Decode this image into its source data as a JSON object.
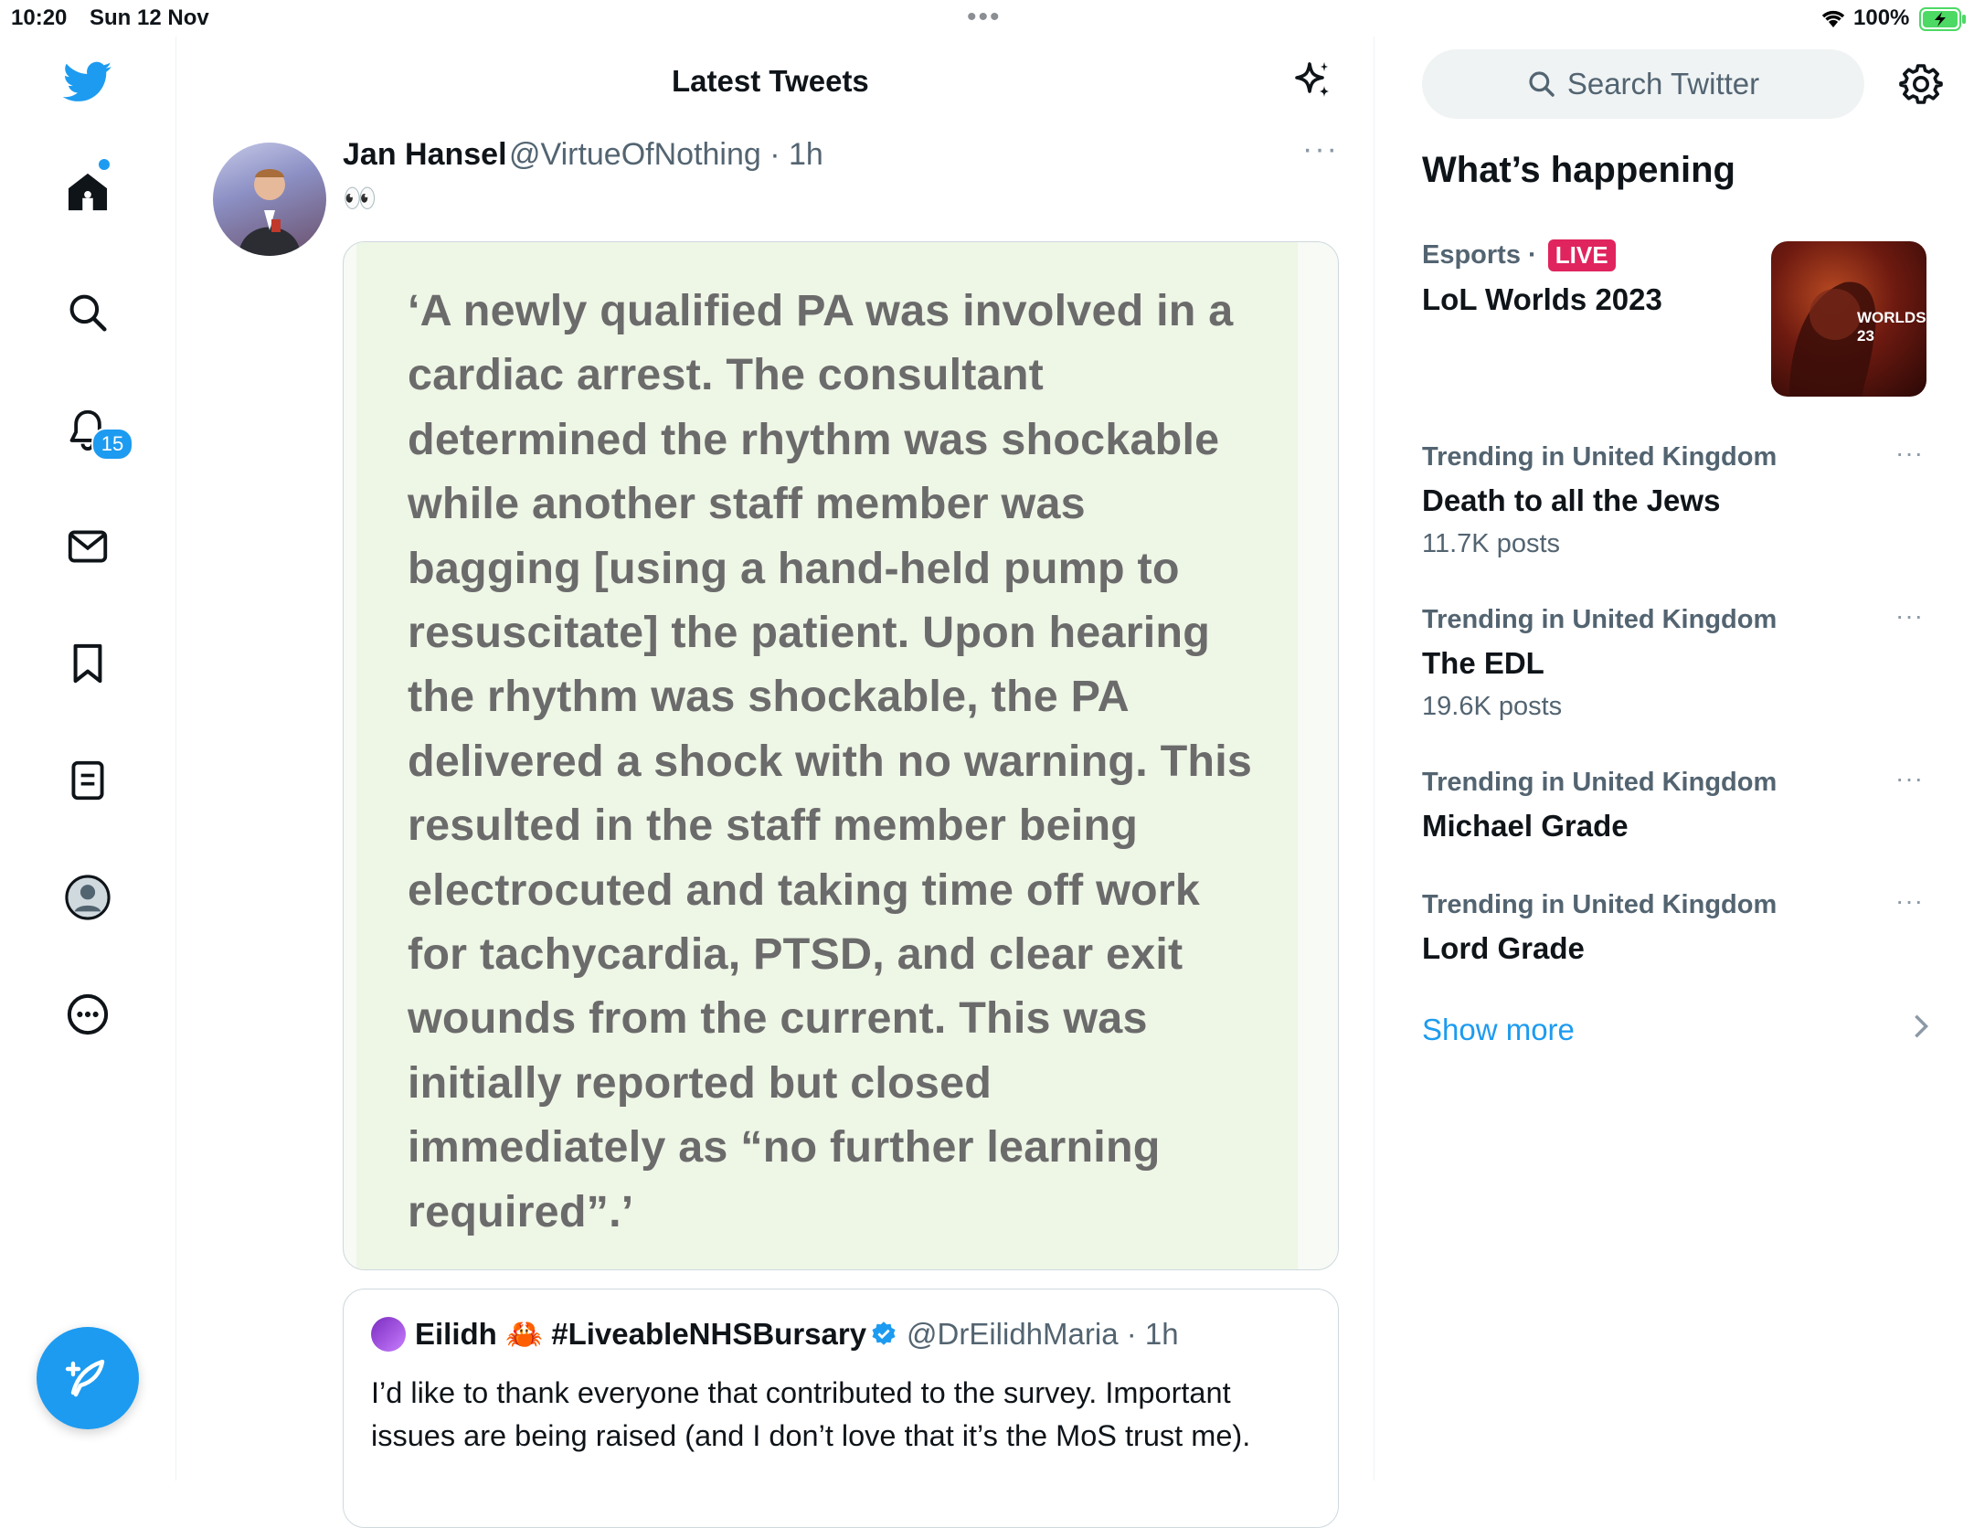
{
  "status_bar": {
    "time": "10:20",
    "date": "Sun 12 Nov",
    "battery": "100%",
    "dots": "•••"
  },
  "sidebar": {
    "items": [
      {
        "name": "home",
        "icon": "home-icon"
      },
      {
        "name": "explore",
        "icon": "search-icon"
      },
      {
        "name": "notifications",
        "icon": "bell-icon",
        "badge": "15"
      },
      {
        "name": "messages",
        "icon": "envelope-icon"
      },
      {
        "name": "bookmarks",
        "icon": "bookmark-icon"
      },
      {
        "name": "lists",
        "icon": "list-icon"
      },
      {
        "name": "profile",
        "icon": "profile-icon"
      },
      {
        "name": "more",
        "icon": "more-circle-icon"
      }
    ],
    "notifications_badge": "15"
  },
  "header": {
    "title": "Latest Tweets"
  },
  "tweet": {
    "author_name": "Jan Hansel",
    "author_handle": "@VirtueOfNothing · 1h",
    "more": "···",
    "text": "👀",
    "media_text": "‘A newly qualified PA was involved in a cardiac arrest. The consultant determined the rhythm was shockable while another staff member was bagging [using a hand-held pump to resuscitate] the patient. Upon hearing the rhythm was shockable, the PA delivered a shock with no warning. This resulted in the staff member being electrocuted and taking time off work for tachycardia, PTSD, and clear exit wounds from the current. This was initially reported but closed immediately as “no further learning required”.’",
    "quote": {
      "name": "Eilidh 🦀 #LiveableNHSBursary",
      "handle": "@DrEilidhMaria · 1h",
      "text": "I’d like to thank everyone that contributed to the survey. Important issues are being raised (and I don’t love that it’s the MoS trust me)."
    }
  },
  "right": {
    "search_placeholder": "Search Twitter",
    "section_title": "What’s happening",
    "esports": {
      "context": "Esports ·",
      "live": "LIVE",
      "title": "LoL Worlds 2023",
      "thumb_text": "WORLDS 23"
    },
    "trends": [
      {
        "context": "Trending in United Kingdom",
        "title": "Death to all the Jews",
        "count": "11.7K posts"
      },
      {
        "context": "Trending in United Kingdom",
        "title": "The EDL",
        "count": "19.6K posts"
      },
      {
        "context": "Trending in United Kingdom",
        "title": "Michael Grade",
        "count": ""
      },
      {
        "context": "Trending in United Kingdom",
        "title": "Lord Grade",
        "count": ""
      }
    ],
    "trend_more": "···",
    "show_more": "Show more"
  },
  "colors": {
    "accent": "#1d9bf0",
    "live": "#e0245e",
    "secondary_text": "#536471"
  }
}
